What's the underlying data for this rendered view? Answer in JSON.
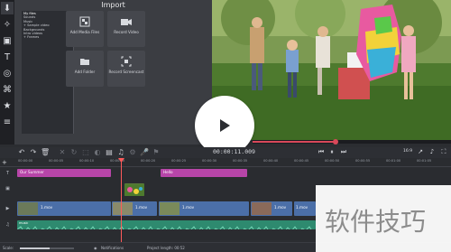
{
  "import_panel": {
    "title": "Import",
    "folder_tree": [
      "My files",
      "Sounds",
      "Music",
      "+ Sample video",
      "Backgrounds",
      "Intro videos",
      "+ Frames"
    ],
    "buttons": [
      {
        "label": "Add Media Files",
        "icon": "add-media-files-icon"
      },
      {
        "label": "Record Video",
        "icon": "record-video-icon"
      },
      {
        "label": "Add Folder",
        "icon": "add-folder-icon"
      },
      {
        "label": "Record Screencast",
        "icon": "record-screencast-icon"
      }
    ]
  },
  "left_tools": [
    "import-icon",
    "magic-wand-icon",
    "transitions-icon",
    "titles-icon",
    "stickers-icon",
    "filters-icon",
    "stabilization-icon",
    "more-tools-icon"
  ],
  "preview": {
    "timecode": "00:00:11.009",
    "progress": 0.42,
    "aspect_ratio": "16:9"
  },
  "ruler": {
    "ticks": [
      "00:00:00",
      "00:00:05",
      "00:00:10",
      "00:00:15",
      "00:00:20",
      "00:00:25",
      "00:00:30",
      "00:00:35",
      "00:00:40",
      "00:00:45",
      "00:00:50",
      "00:00:55",
      "00:01:00",
      "00:01:05",
      "00:01:10"
    ]
  },
  "timeline": {
    "title_clips": [
      "Our Summer",
      "Hello"
    ],
    "video_clips": [
      "1.mov",
      "1.mov",
      "1.mov",
      "1.mov",
      "1.mov"
    ],
    "audio_clip": "music"
  },
  "statusbar": {
    "scale_label": "Scale:",
    "scale_level": 0.55,
    "notifications_label": "Notifications",
    "project_length_label": "Project length: 00:52"
  },
  "watermark": "软件技巧"
}
